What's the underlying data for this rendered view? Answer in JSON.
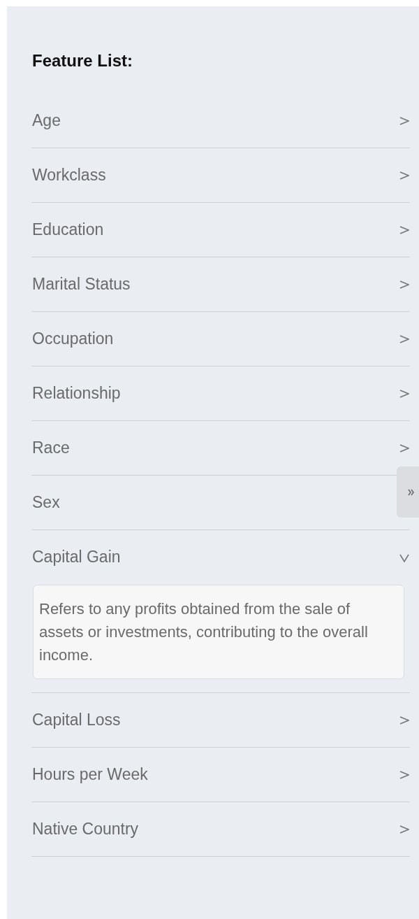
{
  "title": "Feature List:",
  "features": [
    {
      "label": "Age",
      "expanded": false
    },
    {
      "label": "Workclass",
      "expanded": false
    },
    {
      "label": "Education",
      "expanded": false
    },
    {
      "label": "Marital Status",
      "expanded": false
    },
    {
      "label": "Occupation",
      "expanded": false
    },
    {
      "label": "Relationship",
      "expanded": false
    },
    {
      "label": "Race",
      "expanded": false
    },
    {
      "label": "Sex"
    },
    {
      "label": "Capital Gain",
      "expanded": true,
      "description": "Refers to any profits obtained from the sale of assets or investments, contributing to the overall income."
    },
    {
      "label": "Capital Loss",
      "expanded": false
    },
    {
      "label": "Hours per Week",
      "expanded": false
    },
    {
      "label": "Native Country",
      "expanded": false
    }
  ]
}
